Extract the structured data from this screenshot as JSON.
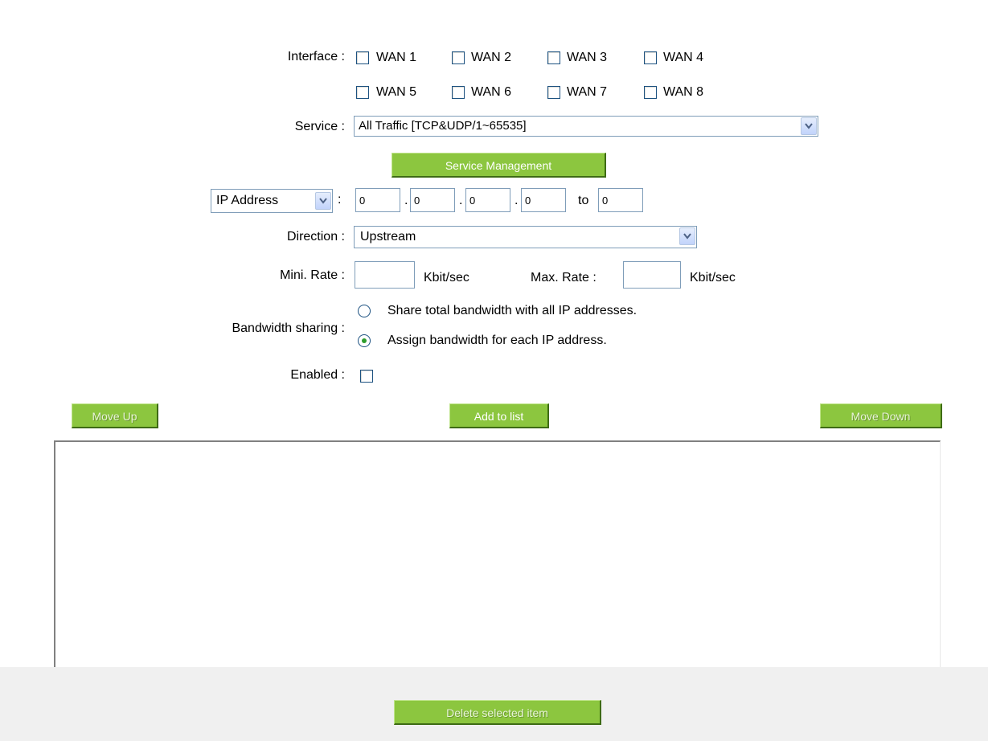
{
  "form": {
    "interface_label": "Interface :",
    "wan_options": [
      "WAN 1",
      "WAN 2",
      "WAN 3",
      "WAN 4",
      "WAN 5",
      "WAN 6",
      "WAN 7",
      "WAN 8"
    ],
    "service_label": "Service :",
    "service_value": "All Traffic [TCP&UDP/1~65535]",
    "service_management_button": "Service Management",
    "ip_type_value": "IP Address",
    "ip_colon": ":",
    "ip_octets": [
      "0",
      "0",
      "0",
      "0"
    ],
    "ip_dot": ".",
    "ip_to_label": "to",
    "ip_to_value": "0",
    "direction_label": "Direction :",
    "direction_value": "Upstream",
    "min_rate_label": "Mini. Rate :",
    "min_rate_value": "",
    "rate_unit": "Kbit/sec",
    "max_rate_label": "Max. Rate :",
    "max_rate_value": "",
    "bandwidth_label": "Bandwidth sharing :",
    "bandwidth_options": [
      {
        "label": "Share total bandwidth with all IP addresses.",
        "selected": false
      },
      {
        "label": "Assign bandwidth for each IP address.",
        "selected": true
      }
    ],
    "enabled_label": "Enabled :",
    "enabled_checked": false
  },
  "list_controls": {
    "move_up": "Move Up",
    "add_to_list": "Add to list",
    "move_down": "Move Down",
    "delete_selected": "Delete selected item"
  },
  "colors": {
    "button_green": "#8cc63f",
    "radio_selected": "#2e9d2e"
  }
}
